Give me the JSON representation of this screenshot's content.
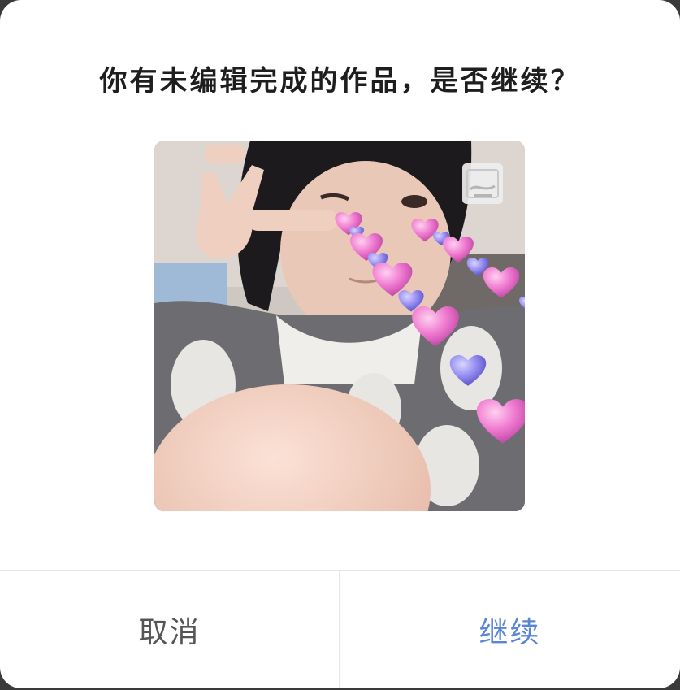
{
  "dialog": {
    "title": "你有未编辑完成的作品，是否继续？",
    "cancel_label": "取消",
    "continue_label": "继续"
  },
  "preview": {
    "badge_icon": "gallery-icon"
  },
  "colors": {
    "accent": "#5a84d6",
    "title": "#1e1e1e",
    "cancel": "#555555"
  }
}
